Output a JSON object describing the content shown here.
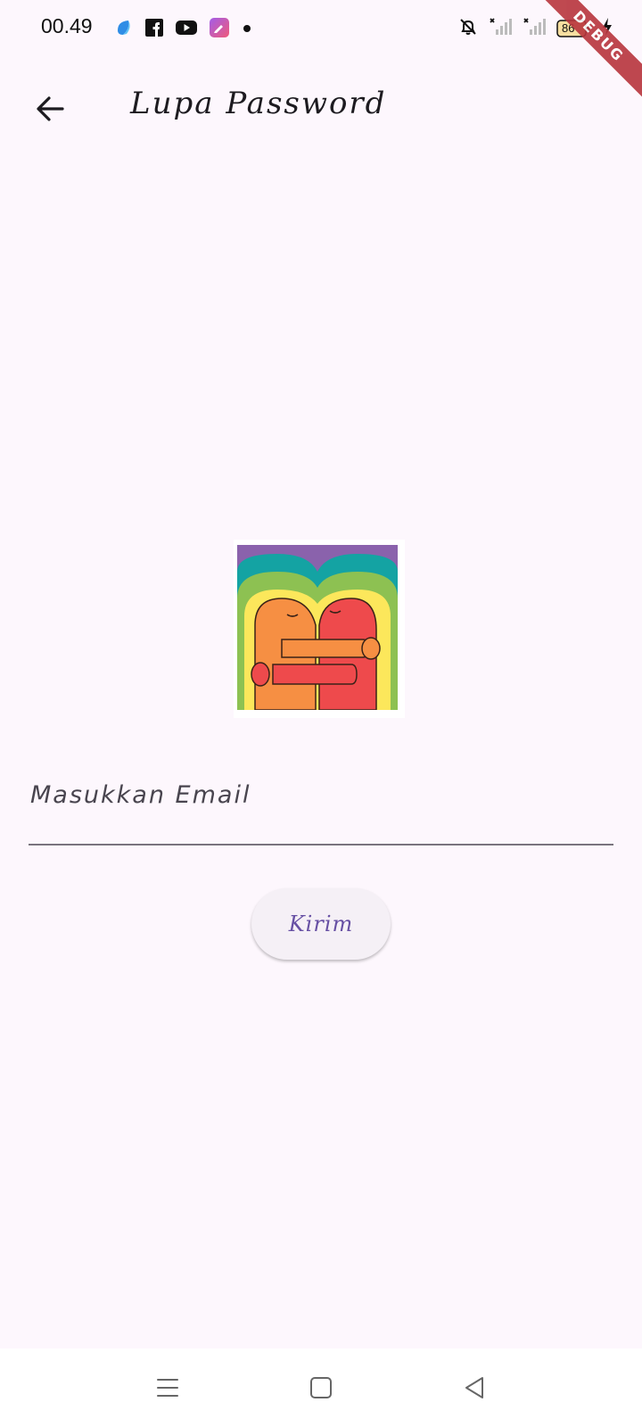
{
  "status_bar": {
    "time": "00.49",
    "battery_level": "86",
    "left_icons": [
      "app-blue-icon",
      "facebook-icon",
      "youtube-icon",
      "app-pink-icon",
      "notification-dot-icon"
    ],
    "right_icons": [
      "bell-off-icon",
      "signal-no-sim-icon",
      "signal-no-sim-icon",
      "battery-icon",
      "charging-icon"
    ]
  },
  "debug_banner": {
    "label": "DEBUG",
    "color": "#b8353d"
  },
  "app_bar": {
    "title": "Lupa Password",
    "back_icon": "arrow-left-icon"
  },
  "illustration": {
    "icon": "hugging-figures-illustration",
    "colors": [
      "#8a62ac",
      "#14a3a3",
      "#8dc152",
      "#fce75b",
      "#f68f43",
      "#ee4a4c"
    ]
  },
  "form": {
    "email_label": "Masukkan Email",
    "email_value": "",
    "send_label": "Kirim"
  },
  "nav_bar": {
    "buttons": [
      "menu-icon",
      "home-square-icon",
      "back-triangle-icon"
    ]
  },
  "theme": {
    "background": "#fdf7fd",
    "accent": "#6750a4"
  }
}
